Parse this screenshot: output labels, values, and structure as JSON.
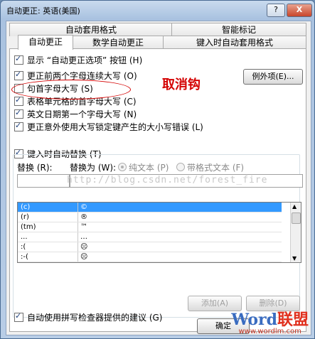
{
  "window": {
    "title": "自动更正: 英语(美国)",
    "help_label": "?",
    "close_label": "X"
  },
  "tabs_back": [
    "自动套用格式",
    "智能标记"
  ],
  "tabs_front": [
    "自动更正",
    "数学自动更正",
    "键入时自动套用格式"
  ],
  "options": [
    {
      "label": "显示 “自动更正选项” 按钮 (H)",
      "checked": true
    },
    {
      "label": "更正前两个字母连续大写 (O)",
      "checked": true
    },
    {
      "label": "句首字母大写 (S)",
      "checked": false
    },
    {
      "label": "表格单元格的首字母大写 (C)",
      "checked": true
    },
    {
      "label": "英文日期第一个字母大写 (N)",
      "checked": true
    },
    {
      "label": "更正意外使用大写锁定键产生的大小写错误 (L)",
      "checked": true
    }
  ],
  "exceptions_button": "例外项(E)...",
  "annotation": "取消钩",
  "replace_section": {
    "checkbox_label": "键入时自动替换 (T)",
    "checked": true,
    "replace_label": "替换 (R):",
    "with_label": "替换为 (W):",
    "plain_text": "纯文本 (P)",
    "formatted_text": "带格式文本 (F)",
    "watermark": "http://blog.csdn.net/forest_fire"
  },
  "list_rows": [
    {
      "from": "(c)",
      "to": "©",
      "selected": true
    },
    {
      "from": "(r)",
      "to": "®",
      "selected": false
    },
    {
      "from": "(tm)",
      "to": "™",
      "selected": false
    },
    {
      "from": "...",
      "to": "…",
      "selected": false
    },
    {
      "from": ":(",
      "to": "☹",
      "selected": false
    },
    {
      "from": ":-(",
      "to": "☹",
      "selected": false
    }
  ],
  "add_button": "添加(A)",
  "delete_button": "删除(D)",
  "spellcheck_option": {
    "label": "自动使用拼写检查器提供的建议 (G)",
    "checked": true
  },
  "ok_button": "确定",
  "logo": {
    "word": "Word",
    "cn": "联盟",
    "url": "www.wordlm.com"
  }
}
